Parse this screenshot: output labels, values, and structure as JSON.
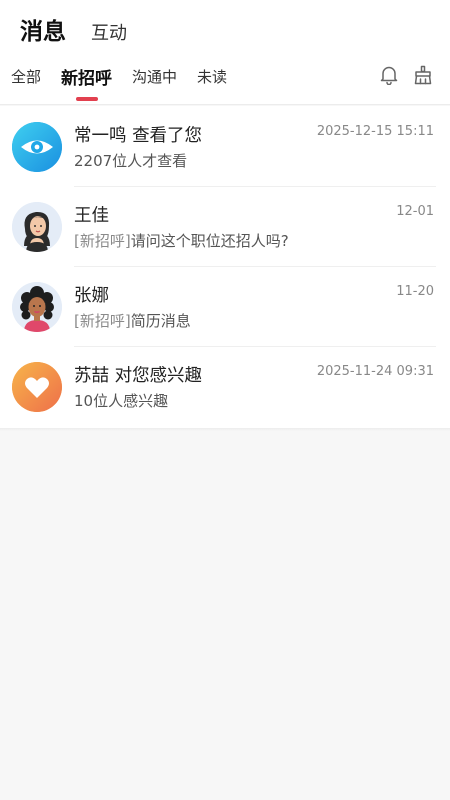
{
  "header": {
    "tabs": [
      {
        "label": "消息"
      },
      {
        "label": "互动"
      }
    ]
  },
  "filter_tabs": [
    {
      "label": "全部"
    },
    {
      "label": "新招呼"
    },
    {
      "label": "沟通中"
    },
    {
      "label": "未读"
    }
  ],
  "icons": {
    "bell": "bell-icon",
    "clear": "broom-icon"
  },
  "messages": [
    {
      "name": "常一鸣  查看了您",
      "preview": "2207位人才查看",
      "tag": "",
      "time": "2025-12-15 15:11",
      "avatar": "eye-icon",
      "avatar_color": "#1fa8e8"
    },
    {
      "name": "王佳",
      "tag": "[新招呼]",
      "preview": "请问这个职位还招人吗?",
      "time": "12-01",
      "avatar": "woman-avatar",
      "avatar_color": "#e4ecf7"
    },
    {
      "name": "张娜",
      "tag": "[新招呼]",
      "preview": "简历消息",
      "time": "11-20",
      "avatar": "woman-curly-avatar",
      "avatar_color": "#e4ecf7"
    },
    {
      "name": "苏喆  对您感兴趣",
      "preview": "10位人感兴趣",
      "tag": "",
      "time": "2025-11-24 09:31",
      "avatar": "heart-icon",
      "avatar_color": "#f39a3a"
    }
  ],
  "colors": {
    "accent": "#e2404f",
    "eye_blue": "#1fa8e8",
    "heart_orange": "#f39a3a"
  }
}
